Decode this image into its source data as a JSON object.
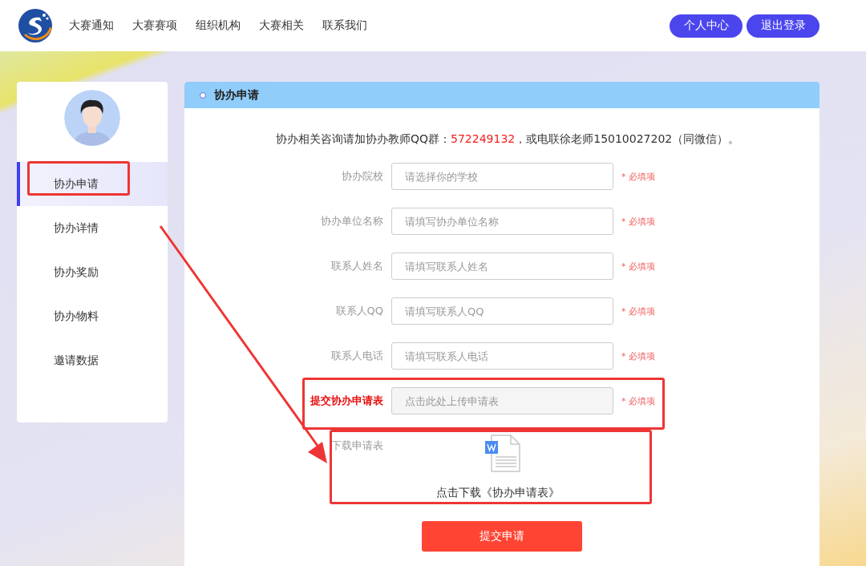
{
  "header": {
    "nav": [
      "大赛通知",
      "大赛赛项",
      "组织机构",
      "大赛相关",
      "联系我们"
    ],
    "buttons": [
      "个人中心",
      "退出登录"
    ]
  },
  "sidebar": {
    "items": [
      {
        "label": "协办申请",
        "selected": true,
        "highlighted": true
      },
      {
        "label": "协办详情",
        "selected": false,
        "highlighted": false
      },
      {
        "label": "协办奖励",
        "selected": false,
        "highlighted": false
      },
      {
        "label": "协办物料",
        "selected": false,
        "highlighted": false
      },
      {
        "label": "邀请数据",
        "selected": false,
        "highlighted": false
      }
    ]
  },
  "panel": {
    "title": "协办申请",
    "notice": {
      "prefix": "协办相关咨询请加协办教师QQ群：",
      "highlight": "572249132",
      "suffix": "，或电联徐老师15010027202（同微信）。"
    },
    "fields": [
      {
        "kind": "input",
        "label": "协办院校",
        "placeholder": "请选择你的学校",
        "note": "* 必填项",
        "highlighted": false
      },
      {
        "kind": "input",
        "label": "协办单位名称",
        "placeholder": "请填写协办单位名称",
        "note": "* 必填项",
        "highlighted": false
      },
      {
        "kind": "input",
        "label": "联系人姓名",
        "placeholder": "请填写联系人姓名",
        "note": "* 必填项",
        "highlighted": false
      },
      {
        "kind": "input",
        "label": "联系人QQ",
        "placeholder": "请填写联系人QQ",
        "note": "* 必填项",
        "highlighted": false
      },
      {
        "kind": "input",
        "label": "联系人电话",
        "placeholder": "请填写联系人电话",
        "note": "* 必填项",
        "highlighted": false
      },
      {
        "kind": "upload",
        "label": "提交协办申请表",
        "placeholder": "点击此处上传申请表",
        "note": "* 必填项",
        "highlighted": true
      }
    ],
    "download": {
      "label": "下载申请表",
      "link": "点击下载《协办申请表》",
      "highlighted": true
    },
    "submit": "提交申请"
  },
  "annotation_arrow": true
}
